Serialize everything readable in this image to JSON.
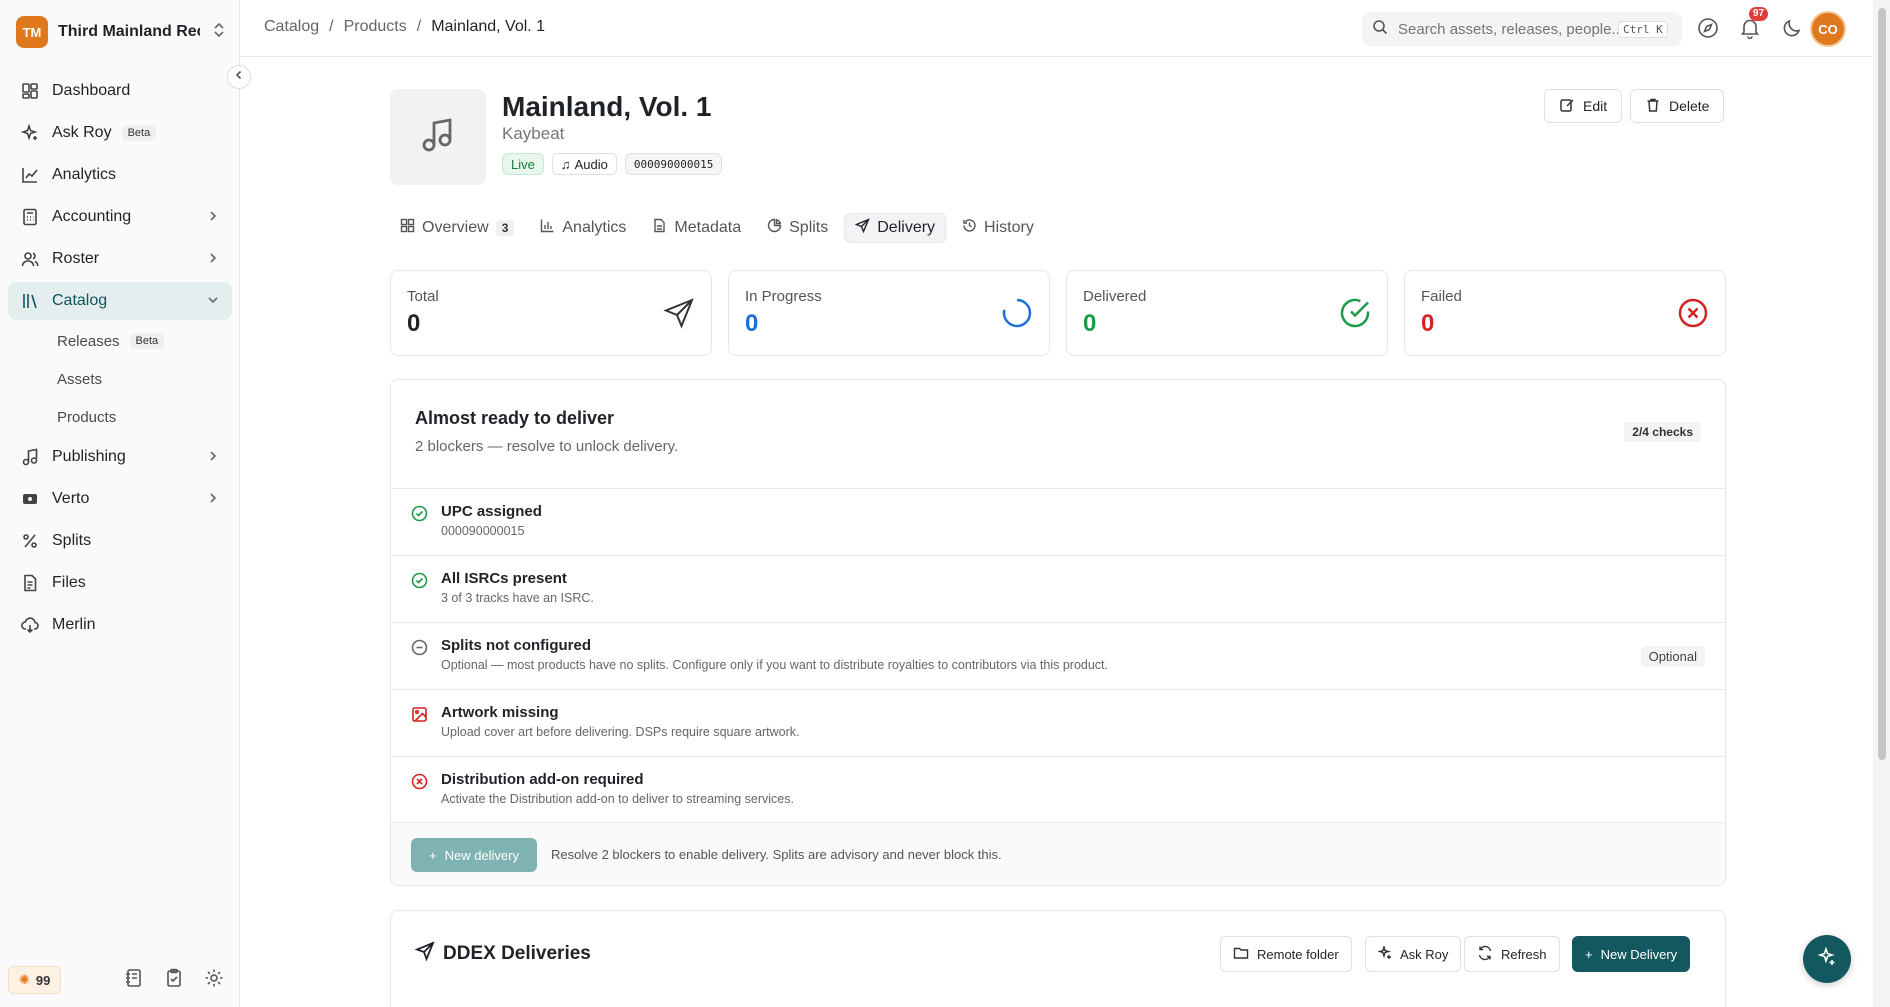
{
  "org": {
    "initials": "TM",
    "name": "Third Mainland Rec..."
  },
  "nav": {
    "dashboard": "Dashboard",
    "ask_roy": "Ask Roy",
    "ask_roy_badge": "Beta",
    "analytics": "Analytics",
    "accounting": "Accounting",
    "roster": "Roster",
    "catalog": "Catalog",
    "releases": "Releases",
    "releases_badge": "Beta",
    "assets": "Assets",
    "products": "Products",
    "publishing": "Publishing",
    "verto": "Verto",
    "splits": "Splits",
    "files": "Files",
    "merlin": "Merlin"
  },
  "sidebar_bottom": {
    "points": "99"
  },
  "breadcrumb": {
    "catalog": "Catalog",
    "products": "Products",
    "current": "Mainland, Vol. 1",
    "sep": "/"
  },
  "search": {
    "placeholder": "Search assets, releases, people...",
    "shortcut": "Ctrl K"
  },
  "notifications": {
    "count": "97"
  },
  "user": {
    "initials": "CO"
  },
  "product": {
    "title": "Mainland, Vol. 1",
    "artist": "Kaybeat",
    "status": "Live",
    "type": "Audio",
    "upc": "000090000015",
    "edit": "Edit",
    "delete": "Delete"
  },
  "tabs": {
    "overview": "Overview",
    "overview_count": "3",
    "analytics": "Analytics",
    "metadata": "Metadata",
    "splits": "Splits",
    "delivery": "Delivery",
    "history": "History"
  },
  "stats": {
    "total": {
      "label": "Total",
      "value": "0"
    },
    "in_progress": {
      "label": "In Progress",
      "value": "0"
    },
    "delivered": {
      "label": "Delivered",
      "value": "0"
    },
    "failed": {
      "label": "Failed",
      "value": "0"
    }
  },
  "colors": {
    "accent": "#13585f",
    "success": "#1f9a4a",
    "progress": "#1e6fd9",
    "danger": "#d42424",
    "brand": "#e0781f"
  },
  "readiness": {
    "title": "Almost ready to deliver",
    "subtitle": "2 blockers — resolve to unlock delivery.",
    "checks": "2/4 checks",
    "items": [
      {
        "title": "UPC assigned",
        "desc": "000090000015"
      },
      {
        "title": "All ISRCs present",
        "desc": "3 of 3 tracks have an ISRC."
      },
      {
        "title": "Splits not configured",
        "desc": "Optional — most products have no splits. Configure only if you want to distribute royalties to contributors via this product.",
        "tag": "Optional"
      },
      {
        "title": "Artwork missing",
        "desc": "Upload cover art before delivering. DSPs require square artwork."
      },
      {
        "title": "Distribution add-on required",
        "desc": "Activate the Distribution add-on to deliver to streaming services."
      }
    ],
    "new_delivery": "New delivery",
    "footer_msg": "Resolve 2 blockers to enable delivery. Splits are advisory and never block this."
  },
  "ddex": {
    "title": "DDEX Deliveries",
    "remote_folder": "Remote folder",
    "ask_roy": "Ask Roy",
    "refresh": "Refresh",
    "new_delivery": "New Delivery"
  }
}
